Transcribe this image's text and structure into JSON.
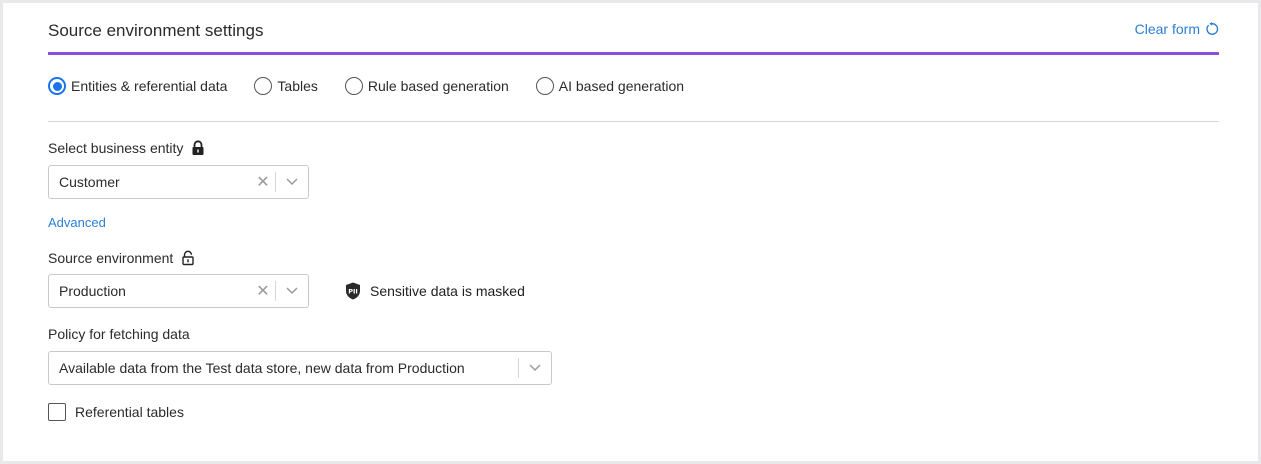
{
  "header": {
    "title": "Source environment settings",
    "clear_form_label": "Clear form",
    "accent_color": "#8a4fdc"
  },
  "source_type": {
    "options": [
      "Entities & referential data",
      "Tables",
      "Rule based generation",
      "AI based generation"
    ],
    "selected": "Entities & referential data"
  },
  "business_entity": {
    "label": "Select business entity",
    "lock_icon": "lock-closed-icon",
    "value": "Customer"
  },
  "advanced_link": "Advanced",
  "source_environment": {
    "label": "Source environment",
    "lock_icon": "lock-open-icon",
    "value": "Production",
    "pii_badge": "PII",
    "pii_text": "Sensitive data is masked"
  },
  "policy": {
    "label": "Policy for fetching data",
    "value": "Available data from the Test data store, new data from Production"
  },
  "referential_tables": {
    "label": "Referential tables",
    "checked": false
  }
}
